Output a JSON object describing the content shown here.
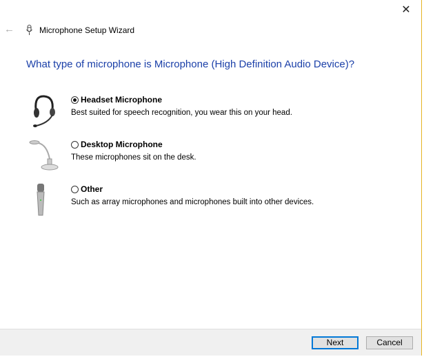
{
  "window": {
    "title": "Microphone Setup Wizard",
    "close_icon": "close-icon",
    "back_icon": "back-arrow-icon"
  },
  "question": "What type of microphone is Microphone (High Definition Audio Device)?",
  "options": [
    {
      "label": "Headset Microphone",
      "description": "Best suited for speech recognition, you wear this on your head.",
      "selected": true,
      "icon": "headset-icon"
    },
    {
      "label": "Desktop Microphone",
      "description": "These microphones sit on the desk.",
      "selected": false,
      "icon": "desktop-microphone-icon"
    },
    {
      "label": "Other",
      "description": "Such as array microphones and microphones built into other devices.",
      "selected": false,
      "icon": "handheld-microphone-icon"
    }
  ],
  "buttons": {
    "next": "Next",
    "cancel": "Cancel"
  },
  "colors": {
    "accent": "#0078d7",
    "heading": "#1a3fa8"
  }
}
